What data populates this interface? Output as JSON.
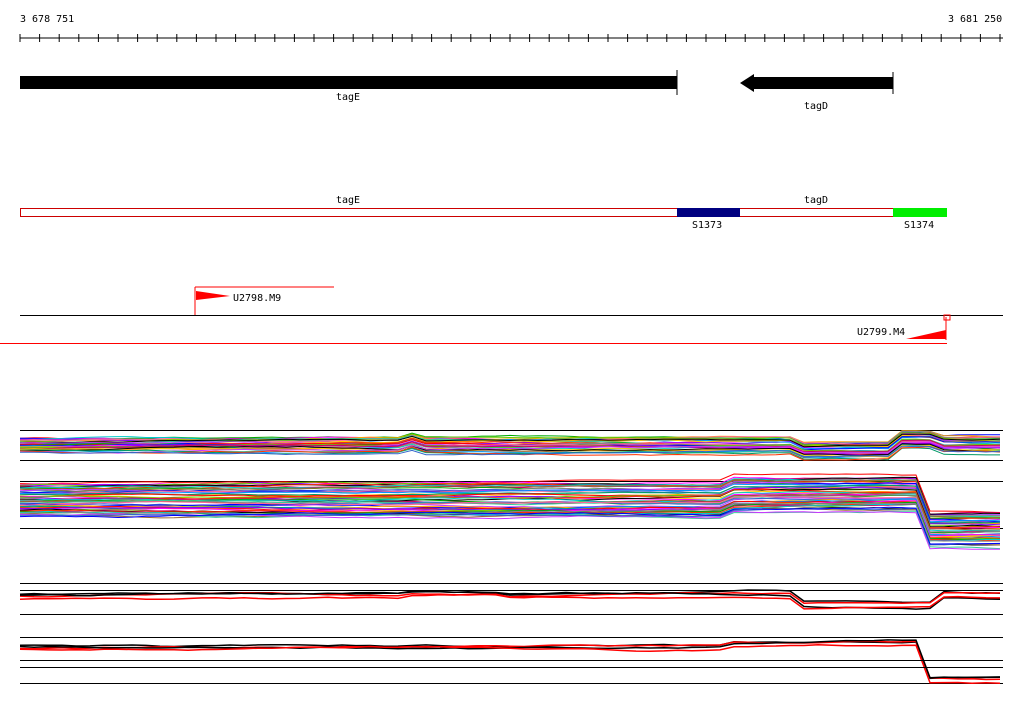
{
  "ruler": {
    "start_label": "3 678 751",
    "end_label": "3 681 250"
  },
  "genes": [
    {
      "name": "tagE",
      "strand": "+"
    },
    {
      "name": "tagD",
      "strand": "-"
    }
  ],
  "annotation_track": {
    "labels": [
      {
        "text": "tagE"
      },
      {
        "text": "tagD"
      }
    ],
    "segments": [
      {
        "name": "S1373",
        "color": "#000080"
      },
      {
        "name": "S1374",
        "color": "#00ee00"
      }
    ],
    "outline_color": "#cc0000"
  },
  "primers": [
    {
      "name": "U2798.M9",
      "strand": "+"
    },
    {
      "name": "U2799.M4",
      "strand": "-"
    }
  ],
  "colors": {
    "gene": "#000000",
    "red": "#ff0000",
    "axis": "#000000"
  }
}
